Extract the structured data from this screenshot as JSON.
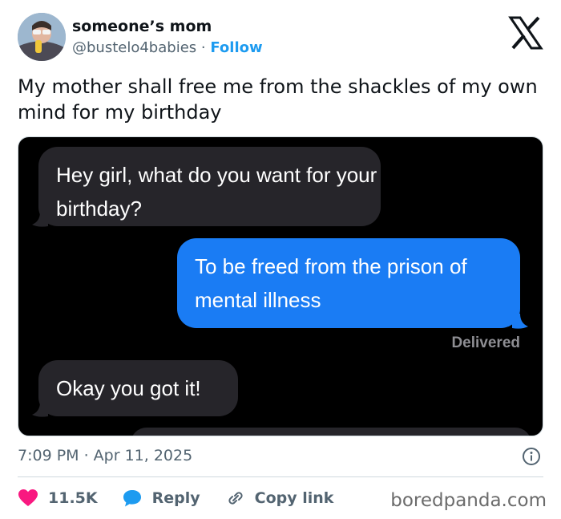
{
  "user": {
    "display_name": "someone’s mom",
    "handle": "@bustelo4babies",
    "separator": "·",
    "follow_label": "Follow"
  },
  "tweet": {
    "text": "My mother shall free me from the shackles of my own mind for my birthday",
    "timestamp": "7:09 PM · Apr 11, 2025"
  },
  "messages": {
    "incoming_1": "Hey girl, what do you want for your birthday?",
    "outgoing_1": "To be freed from the prison of mental illness",
    "status": "Delivered",
    "incoming_2": "Okay you got it!"
  },
  "actions": {
    "likes": "11.5K",
    "reply_label": "Reply",
    "copy_link_label": "Copy link"
  },
  "watermark": "boredpanda.com",
  "colors": {
    "accent": "#1d9bf0",
    "like": "#f91880",
    "imessage_blue": "#1a7cf4",
    "incoming_gray": "#26252a"
  },
  "icons": [
    "x-logo-icon",
    "info-icon",
    "heart-icon",
    "reply-bubble-icon",
    "link-icon"
  ]
}
